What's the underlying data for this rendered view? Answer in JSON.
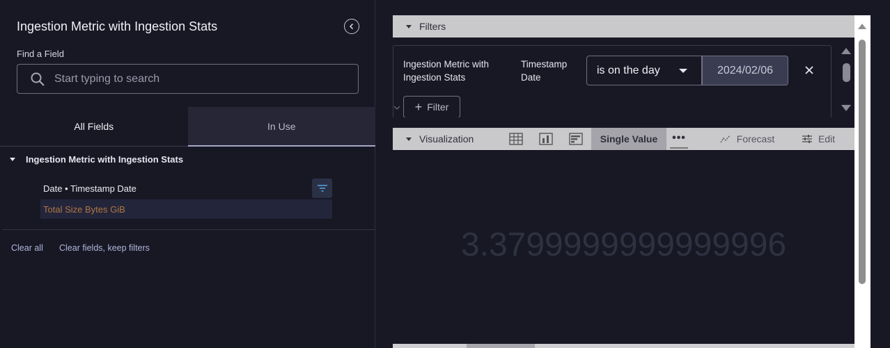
{
  "sidebar": {
    "title": "Ingestion Metric with Ingestion Stats",
    "find_label": "Find a Field",
    "search_placeholder": "Start typing to search",
    "tabs": [
      {
        "label": "All Fields"
      },
      {
        "label": "In Use"
      }
    ],
    "group": {
      "label": "Ingestion Metric with Ingestion Stats",
      "fields": [
        {
          "label": "Date • Timestamp Date"
        },
        {
          "label": "Total Size Bytes GiB"
        }
      ]
    },
    "clear_all": "Clear all",
    "clear_keep": "Clear fields, keep filters"
  },
  "filters": {
    "section_label": "Filters",
    "view_label": "Ingestion Metric with Ingestion Stats",
    "field_label": "Timestamp Date",
    "operator": "is on the day",
    "value": "2024/02/06",
    "add_label": "Filter"
  },
  "visualization": {
    "section_label": "Visualization",
    "single_value_label": "Single Value",
    "more_label": "•••",
    "forecast_label": "Forecast",
    "edit_label": "Edit",
    "value": "3.3799999999999996"
  },
  "colors": {
    "background": "#181825",
    "measure_text": "#b07645",
    "bar_bg": "#c9c9cc",
    "active_viz": "#a4a4aa"
  }
}
